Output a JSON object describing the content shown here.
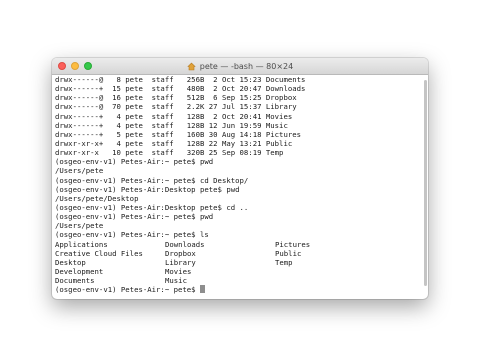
{
  "window": {
    "title": "pete — -bash — 80×24"
  },
  "listing": [
    {
      "perm": "drwx------@",
      "links": "8",
      "owner": "pete",
      "group": "staff",
      "size": "256B",
      "day": "2",
      "month": "Oct",
      "time": "15:23",
      "name": "Documents"
    },
    {
      "perm": "drwx------+",
      "links": "15",
      "owner": "pete",
      "group": "staff",
      "size": "480B",
      "day": "2",
      "month": "Oct",
      "time": "20:47",
      "name": "Downloads"
    },
    {
      "perm": "drwx------@",
      "links": "16",
      "owner": "pete",
      "group": "staff",
      "size": "512B",
      "day": "6",
      "month": "Sep",
      "time": "15:25",
      "name": "Dropbox"
    },
    {
      "perm": "drwx------@",
      "links": "70",
      "owner": "pete",
      "group": "staff",
      "size": "2.2K",
      "day": "27",
      "month": "Jul",
      "time": "15:37",
      "name": "Library"
    },
    {
      "perm": "drwx------+",
      "links": "4",
      "owner": "pete",
      "group": "staff",
      "size": "128B",
      "day": "2",
      "month": "Oct",
      "time": "20:41",
      "name": "Movies"
    },
    {
      "perm": "drwx------+",
      "links": "4",
      "owner": "pete",
      "group": "staff",
      "size": "128B",
      "day": "12",
      "month": "Jun",
      "time": "19:59",
      "name": "Music"
    },
    {
      "perm": "drwx------+",
      "links": "5",
      "owner": "pete",
      "group": "staff",
      "size": "160B",
      "day": "30",
      "month": "Aug",
      "time": "14:18",
      "name": "Pictures"
    },
    {
      "perm": "drwxr-xr-x+",
      "links": "4",
      "owner": "pete",
      "group": "staff",
      "size": "128B",
      "day": "22",
      "month": "May",
      "time": "13:21",
      "name": "Public"
    },
    {
      "perm": "drwxr-xr-x",
      "links": "10",
      "owner": "pete",
      "group": "staff",
      "size": "320B",
      "day": "25",
      "month": "Sep",
      "time": "08:19",
      "name": "Temp"
    }
  ],
  "session": [
    "(osgeo-env-v1) Petes-Air:~ pete$ pwd",
    "/Users/pete",
    "(osgeo-env-v1) Petes-Air:~ pete$ cd Desktop/",
    "(osgeo-env-v1) Petes-Air:Desktop pete$ pwd",
    "/Users/pete/Desktop",
    "(osgeo-env-v1) Petes-Air:Desktop pete$ cd ..",
    "(osgeo-env-v1) Petes-Air:~ pete$ pwd",
    "/Users/pete",
    "(osgeo-env-v1) Petes-Air:~ pete$ ls"
  ],
  "ls_output": {
    "col1": [
      "Applications",
      "Creative Cloud Files",
      "Desktop",
      "Development",
      "Documents"
    ],
    "col2": [
      "Downloads",
      "Dropbox",
      "Library",
      "Movies",
      "Music"
    ],
    "col3": [
      "Pictures",
      "Public",
      "Temp"
    ]
  },
  "prompt": "(osgeo-env-v1) Petes-Air:~ pete$ "
}
